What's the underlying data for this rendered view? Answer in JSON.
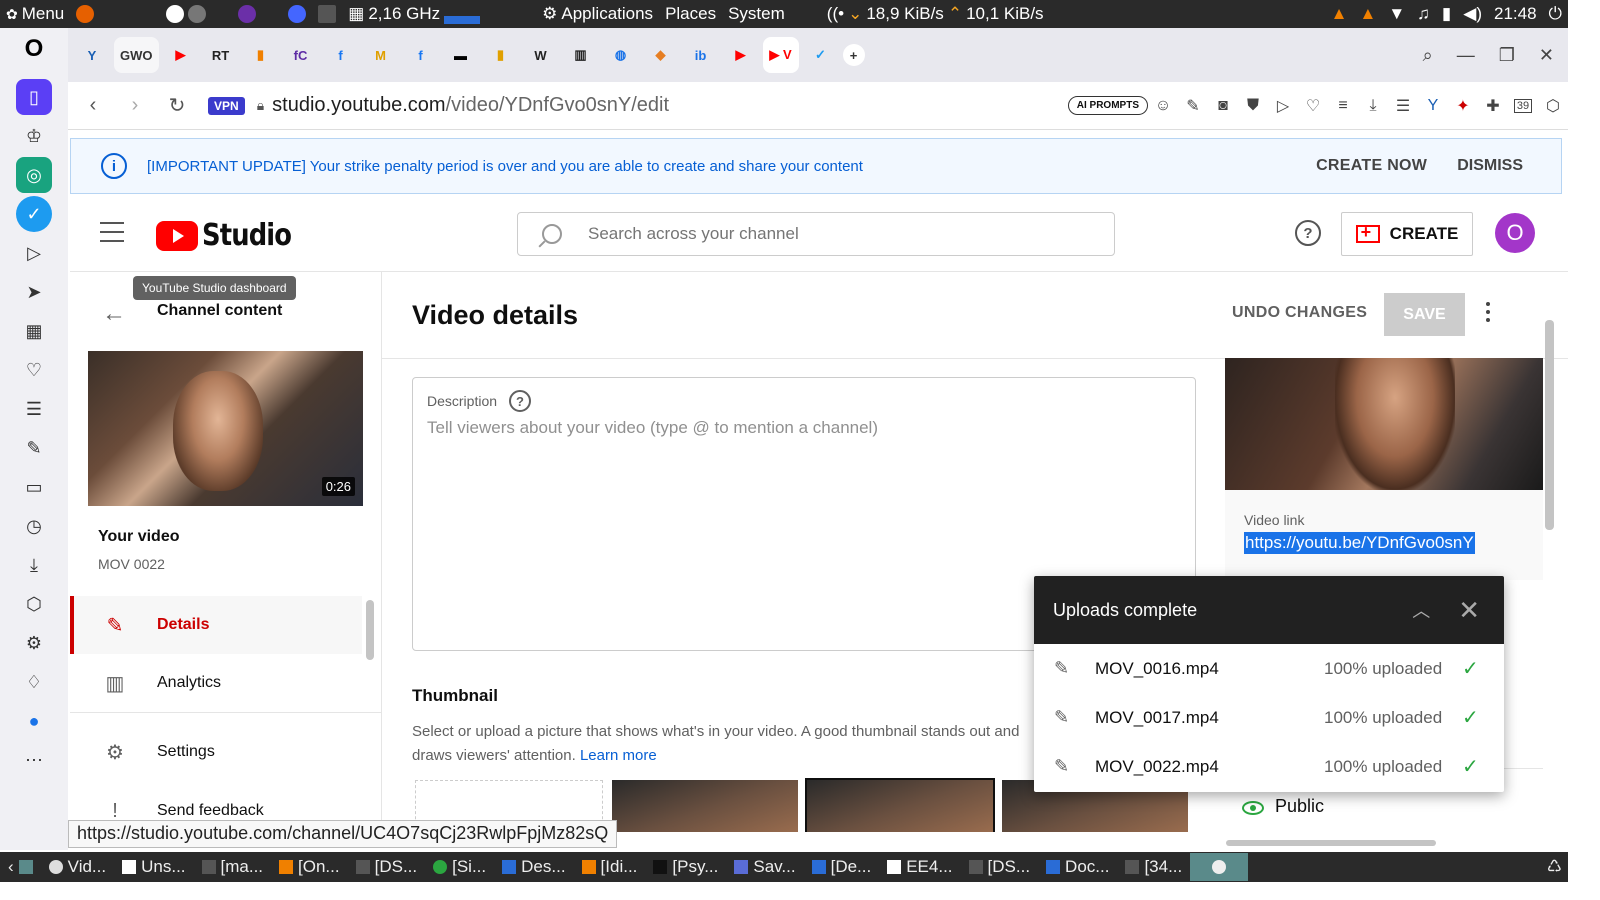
{
  "os_panel": {
    "menu_label": "Menu",
    "cpu": "2,16 GHz",
    "applications": "Applications",
    "places": "Places",
    "system": "System",
    "net_down": "18,9 KiB/s",
    "net_up": "10,1 KiB/s",
    "clock": "21:48"
  },
  "browser": {
    "url_prefix": "studio.youtube.com",
    "url_path": "/video/YDnfGvo0snY/edit",
    "vpn_label": "VPN",
    "ai_prompts_label": "AI PROMPTS",
    "new_tab": "+",
    "tabs": [
      "GWO",
      "RT",
      "fC",
      "W"
    ],
    "ext_badge": "39"
  },
  "banner": {
    "message": "[IMPORTANT UPDATE] Your strike penalty period is over and you are able to create and share your content",
    "create_now": "CREATE NOW",
    "dismiss": "DISMISS"
  },
  "header": {
    "logo_text": "Studio",
    "search_placeholder": "Search across your channel",
    "create_label": "CREATE",
    "avatar_letter": "O"
  },
  "leftnav": {
    "tooltip": "YouTube Studio dashboard",
    "back_label": "Channel content",
    "duration": "0:26",
    "your_video": "Your video",
    "video_name": "MOV 0022",
    "items": [
      {
        "label": "Details"
      },
      {
        "label": "Analytics"
      },
      {
        "label": "Settings"
      },
      {
        "label": "Send feedback"
      }
    ]
  },
  "main": {
    "title": "Video details",
    "undo": "UNDO CHANGES",
    "save": "SAVE",
    "description_label": "Description",
    "description_placeholder": "Tell viewers about your video (type @ to mention a channel)",
    "thumbnail_title": "Thumbnail",
    "thumbnail_text": "Select or upload a picture that shows what's in your video. A good thumbnail stands out and draws viewers' attention.",
    "learn_more": "Learn more",
    "video_link_label": "Video link",
    "video_link": "https://youtu.be/YDnfGvo0snY",
    "visibility": "Public"
  },
  "uploads": {
    "title": "Uploads complete",
    "rows": [
      {
        "file": "MOV_0016.mp4",
        "status": "100% uploaded"
      },
      {
        "file": "MOV_0017.mp4",
        "status": "100% uploaded"
      },
      {
        "file": "MOV_0022.mp4",
        "status": "100% uploaded"
      }
    ]
  },
  "status_url": "https://studio.youtube.com/channel/UC4O7sqCj23RwlpFpjMz82sQ",
  "taskbar": {
    "tasks": [
      "Vid...",
      "Uns...",
      "[ma...",
      "[On...",
      "[DS...",
      "[Si...",
      "Des...",
      "[Idi...",
      "[Psy...",
      "Sav...",
      "[De...",
      "EE4...",
      "[DS...",
      "Doc...",
      "[34..."
    ]
  },
  "colors": {
    "accent_red": "#ff0000",
    "active_red": "#cc0000",
    "link_blue": "#065fd4",
    "avatar_purple": "#a336c9",
    "check_green": "#2ba640"
  }
}
